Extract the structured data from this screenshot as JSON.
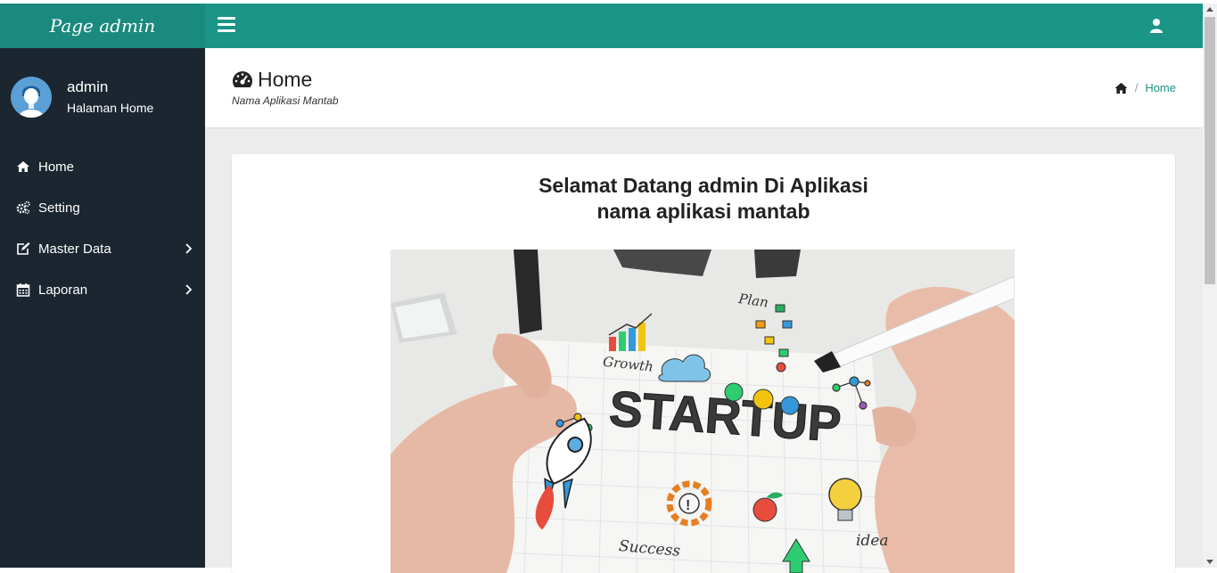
{
  "brand": {
    "logo_text": "Page admin"
  },
  "topbar": {
    "menu_toggle_icon": "bars-icon",
    "user_icon": "user-icon"
  },
  "sidebar": {
    "user": {
      "name": "admin",
      "subtitle": "Halaman Home"
    },
    "items": [
      {
        "label": "Home",
        "icon": "home-icon",
        "has_submenu": false
      },
      {
        "label": "Setting",
        "icon": "cogs-icon",
        "has_submenu": false
      },
      {
        "label": "Master Data",
        "icon": "edit-icon",
        "has_submenu": true
      },
      {
        "label": "Laporan",
        "icon": "calendar-icon",
        "has_submenu": true
      }
    ]
  },
  "header": {
    "title": "Home",
    "subtitle": "Nama Aplikasi Mantab",
    "breadcrumb": {
      "home_icon": "home-icon",
      "separator": "/",
      "current": "Home"
    }
  },
  "main": {
    "welcome_line1": "Selamat Datang admin Di Aplikasi",
    "welcome_line2": "nama aplikasi mantab",
    "image_text": {
      "headline": "STARTUP",
      "growth": "Growth",
      "plan": "Plan",
      "success": "Success",
      "idea": "idea"
    }
  },
  "colors": {
    "topbar": "#1b9587",
    "brand": "#1a8a7e",
    "sidebar": "#1b2630",
    "link": "#1b9587"
  }
}
